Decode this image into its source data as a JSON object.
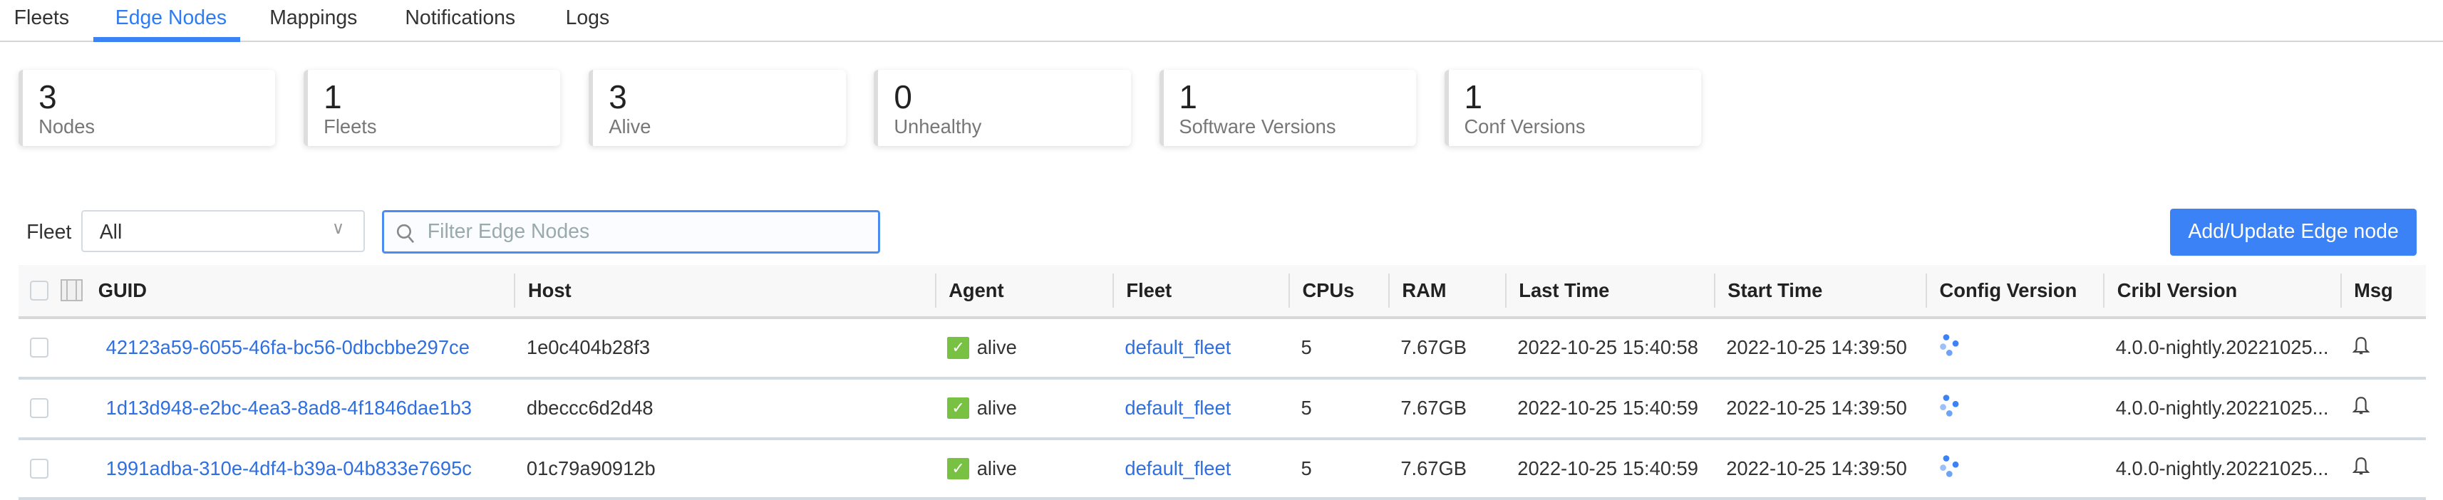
{
  "tabs": [
    {
      "label": "Fleets"
    },
    {
      "label": "Edge Nodes",
      "active": true
    },
    {
      "label": "Mappings"
    },
    {
      "label": "Notifications"
    },
    {
      "label": "Logs"
    }
  ],
  "stats": [
    {
      "value": "3",
      "label": "Nodes"
    },
    {
      "value": "1",
      "label": "Fleets"
    },
    {
      "value": "3",
      "label": "Alive"
    },
    {
      "value": "0",
      "label": "Unhealthy"
    },
    {
      "value": "1",
      "label": "Software Versions"
    },
    {
      "value": "1",
      "label": "Conf Versions"
    }
  ],
  "filter": {
    "fleet_label": "Fleet",
    "fleet_value": "All",
    "search_placeholder": "Filter Edge Nodes",
    "search_value": ""
  },
  "add_button": "Add/Update Edge node",
  "colors": {
    "accent": "#3b82f6",
    "alive": "#79c142",
    "link": "#2f6fe0"
  },
  "table": {
    "headers": [
      "GUID",
      "Host",
      "Agent",
      "Fleet",
      "CPUs",
      "RAM",
      "Last Time",
      "Start Time",
      "Config Version",
      "Cribl Version",
      "Msg"
    ],
    "rows": [
      {
        "guid": "42123a59-6055-46fa-bc56-0dbcbbe297ce",
        "host": "1e0c404b28f3",
        "agent": "alive",
        "fleet": "default_fleet",
        "cpus": "5",
        "ram": "7.67GB",
        "last_time": "2022-10-25 15:40:58",
        "start_time": "2022-10-25 14:39:50",
        "cribl_version": "4.0.0-nightly.20221025..."
      },
      {
        "guid": "1d13d948-e2bc-4ea3-8ad8-4f1846dae1b3",
        "host": "dbeccc6d2d48",
        "agent": "alive",
        "fleet": "default_fleet",
        "cpus": "5",
        "ram": "7.67GB",
        "last_time": "2022-10-25 15:40:59",
        "start_time": "2022-10-25 14:39:50",
        "cribl_version": "4.0.0-nightly.20221025..."
      },
      {
        "guid": "1991adba-310e-4df4-b39a-04b833e7695c",
        "host": "01c79a90912b",
        "agent": "alive",
        "fleet": "default_fleet",
        "cpus": "5",
        "ram": "7.67GB",
        "last_time": "2022-10-25 15:40:59",
        "start_time": "2022-10-25 14:39:50",
        "cribl_version": "4.0.0-nightly.20221025..."
      }
    ]
  }
}
